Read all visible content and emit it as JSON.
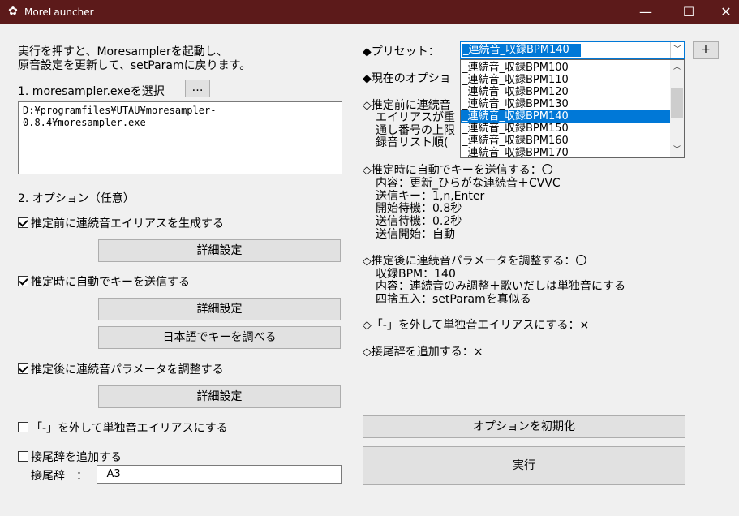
{
  "window": {
    "title": "MoreLauncher",
    "minimize": "—",
    "maximize": "☐",
    "close": "✕"
  },
  "left": {
    "intro_line1": "実行を押すと、Moresamplerを起動し、",
    "intro_line2": "原音設定を更新して、setParamに戻ります。",
    "step1_label": "1. moresampler.exeを選択",
    "browse_label": "…",
    "exe_path": "D:¥programfiles¥UTAU¥moresampler-0.8.4¥moresampler.exe",
    "step2_label": "2. オプション（任意）",
    "opt1_label": "推定前に連続音エイリアスを生成する",
    "opt1_detail": "詳細設定",
    "opt2_label": "推定時に自動でキーを送信する",
    "opt2_detail": "詳細設定",
    "opt2_lookup": "日本語でキーを調べる",
    "opt3_label": "推定後に連続音パラメータを調整する",
    "opt3_detail": "詳細設定",
    "opt4_label": "「-」を外して単独音エイリアスにする",
    "opt5_label": "接尾辞を追加する",
    "suffix_label": "接尾辞　：",
    "suffix_value": "_A3"
  },
  "right": {
    "preset_label": "◆プリセット：",
    "preset_selected": "_連続音_収録BPM140",
    "preset_add": "+",
    "preset_options": [
      "_連続音_収録BPM100",
      "_連続音_収録BPM110",
      "_連続音_収録BPM120",
      "_連続音_収録BPM130",
      "_連続音_収録BPM140",
      "_連続音_収録BPM150",
      "_連続音_収録BPM160",
      "_連続音_収録BPM170"
    ],
    "current_options_label": "◆現在のオプショ",
    "s1_title": "◇推定前に連続音",
    "s1_line1": "エイリアスが重",
    "s1_line2": "通し番号の上限",
    "s1_line3": "録音リスト順(",
    "s2_title": "◇推定時に自動でキーを送信する：〇",
    "s2_line1": "内容：更新_ひらがな連続音＋CVVC",
    "s2_line2": "送信キー：1,n,Enter",
    "s2_line3": "開始待機：0.8秒",
    "s2_line4": "送信待機：0.2秒",
    "s2_line5": "送信開始：自動",
    "s3_title": "◇推定後に連続音パラメータを調整する：〇",
    "s3_line1": "収録BPM：140",
    "s3_line2": "内容：連続音のみ調整＋歌いだしは単独音にする",
    "s3_line3": "四捨五入：setParamを真似る",
    "s4_title": "◇「-」を外して単独音エイリアスにする：×",
    "s5_title": "◇接尾辞を追加する：×",
    "reset_button": "オプションを初期化",
    "run_button": "実行"
  }
}
